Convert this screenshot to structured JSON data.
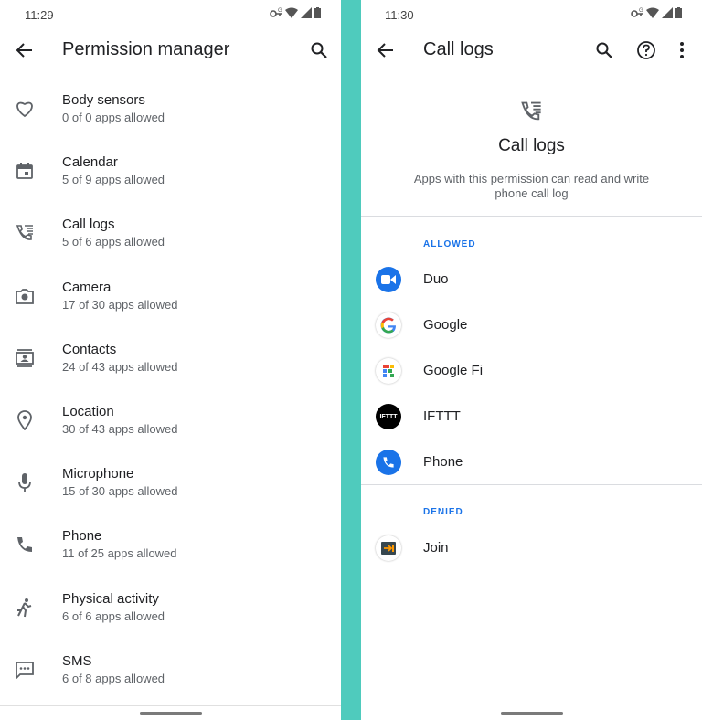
{
  "left": {
    "status_time": "11:29",
    "title": "Permission manager",
    "items": [
      {
        "name": "Body sensors",
        "sub": "0 of 0 apps allowed",
        "icon": "heart-icon"
      },
      {
        "name": "Calendar",
        "sub": "5 of 9 apps allowed",
        "icon": "calendar-icon"
      },
      {
        "name": "Call logs",
        "sub": "5 of 6 apps allowed",
        "icon": "call-log-icon"
      },
      {
        "name": "Camera",
        "sub": "17 of 30 apps allowed",
        "icon": "camera-icon"
      },
      {
        "name": "Contacts",
        "sub": "24 of 43 apps allowed",
        "icon": "contacts-icon"
      },
      {
        "name": "Location",
        "sub": "30 of 43 apps allowed",
        "icon": "location-icon"
      },
      {
        "name": "Microphone",
        "sub": "15 of 30 apps allowed",
        "icon": "microphone-icon"
      },
      {
        "name": "Phone",
        "sub": "11 of 25 apps allowed",
        "icon": "phone-icon"
      },
      {
        "name": "Physical activity",
        "sub": "6 of 6 apps allowed",
        "icon": "running-icon"
      },
      {
        "name": "SMS",
        "sub": "6 of 8 apps allowed",
        "icon": "sms-icon"
      }
    ]
  },
  "right": {
    "status_time": "11:30",
    "title": "Call logs",
    "header_title": "Call logs",
    "header_desc": "Apps with this permission can read and write phone call log",
    "allowed_label": "ALLOWED",
    "denied_label": "DENIED",
    "allowed_apps": [
      {
        "name": "Duo",
        "icon": "duo-icon"
      },
      {
        "name": "Google",
        "icon": "google-icon"
      },
      {
        "name": "Google Fi",
        "icon": "google-fi-icon"
      },
      {
        "name": "IFTTT",
        "icon": "ifttt-icon",
        "icon_text": "IFTTT"
      },
      {
        "name": "Phone",
        "icon": "phone-app-icon"
      }
    ],
    "denied_apps": [
      {
        "name": "Join",
        "icon": "join-icon"
      }
    ]
  },
  "colors": {
    "divider_bg": "#4fcbbd",
    "accent": "#1a73e8",
    "icon_gray": "#5f6368"
  }
}
